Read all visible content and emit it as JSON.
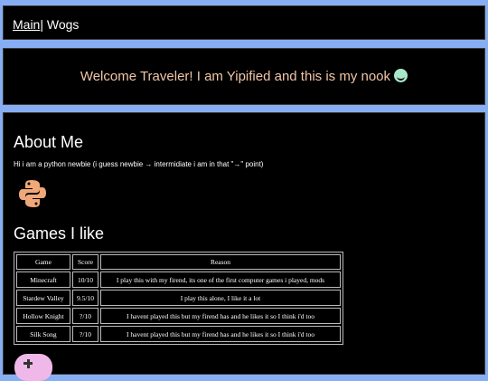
{
  "nav": {
    "main_label": "Main",
    "separator": "|",
    "wogs_label": "Wogs"
  },
  "banner": {
    "welcome_text": "Welcome Traveler! I am Yipified and this is my nook",
    "emoji_icon": "smiling-face-icon"
  },
  "about": {
    "title": "About Me",
    "text": "Hi i am a python newbie (i guess newbie → intermidiate i am in that \"→\" point)",
    "logo_icon": "python-logo-icon"
  },
  "games": {
    "title": "Games I like",
    "headers": [
      "Game",
      "Score",
      "Reason"
    ],
    "rows": [
      [
        "Minecraft",
        "10/10",
        "I play this with my firend, its one of the first computer games i played, mods"
      ],
      [
        "Stardew Valley",
        "9.5/10",
        "I play this alone, I like it a lot"
      ],
      [
        "Hollow Knight",
        "?/10",
        "I havent played this but my firend has and he likes it so I think i'd too"
      ],
      [
        "Silk Song",
        "?/10",
        "I havent played this but my firend has and he likes it so I think i'd too"
      ]
    ]
  },
  "footer_icon": "game-controller-icon",
  "colors": {
    "background": "#87aef2",
    "panel": "#000000",
    "welcome_text": "#f0c6a8",
    "text": "#ffffff"
  }
}
